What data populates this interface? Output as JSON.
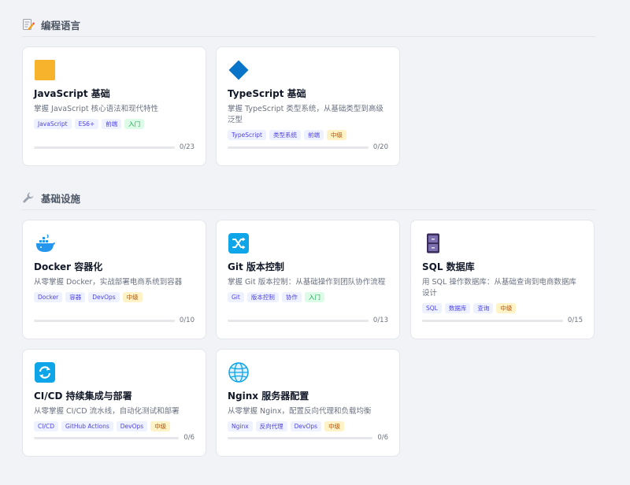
{
  "sections": [
    {
      "title": "编程语言",
      "icon": "memo-icon",
      "cards": [
        {
          "icon": "javascript-logo-icon",
          "title": "JavaScript 基础",
          "desc": "掌握 JavaScript 核心语法和现代特性",
          "tags": [
            "JavaScript",
            "ES6+",
            "前端"
          ],
          "level": "入门",
          "progress": "0/23",
          "progress_fraction": 0
        },
        {
          "icon": "typescript-diamond-icon",
          "title": "TypeScript 基础",
          "desc": "掌握 TypeScript 类型系统，从基础类型到高级泛型",
          "tags": [
            "TypeScript",
            "类型系统",
            "前端"
          ],
          "level": "中级",
          "progress": "0/20",
          "progress_fraction": 0
        }
      ]
    },
    {
      "title": "基础设施",
      "icon": "wrench-icon",
      "cards": [
        {
          "icon": "docker-whale-icon",
          "title": "Docker 容器化",
          "desc": "从零掌握 Docker，实战部署电商系统到容器",
          "tags": [
            "Docker",
            "容器",
            "DevOps"
          ],
          "level": "中级",
          "progress": "0/10",
          "progress_fraction": 0
        },
        {
          "icon": "git-shuffle-icon",
          "title": "Git 版本控制",
          "desc": "掌握 Git 版本控制：从基础操作到团队协作流程",
          "tags": [
            "Git",
            "版本控制",
            "协作"
          ],
          "level": "入门",
          "progress": "0/13",
          "progress_fraction": 0
        },
        {
          "icon": "database-cabinet-icon",
          "title": "SQL 数据库",
          "desc": "用 SQL 操作数据库：从基础查询到电商数据库设计",
          "tags": [
            "SQL",
            "数据库",
            "查询"
          ],
          "level": "中级",
          "progress": "0/15",
          "progress_fraction": 0
        },
        {
          "icon": "cicd-refresh-icon",
          "title": "CI/CD 持续集成与部署",
          "desc": "从零掌握 CI/CD 流水线，自动化测试和部署",
          "tags": [
            "CI/CD",
            "GitHub Actions",
            "DevOps"
          ],
          "level": "中级",
          "progress": "0/6",
          "progress_fraction": 0
        },
        {
          "icon": "globe-icon",
          "title": "Nginx 服务器配置",
          "desc": "从零掌握 Nginx，配置反向代理和负载均衡",
          "tags": [
            "Nginx",
            "反向代理",
            "DevOps"
          ],
          "level": "中级",
          "progress": "0/6",
          "progress_fraction": 0
        }
      ]
    }
  ],
  "colors": {
    "page_bg": "#f1f3f6",
    "tag_bg": "#eef1ff",
    "tag_text": "#4f46e5",
    "level_intro_bg": "#dcfce7",
    "level_mid_bg": "#fef3c7"
  }
}
